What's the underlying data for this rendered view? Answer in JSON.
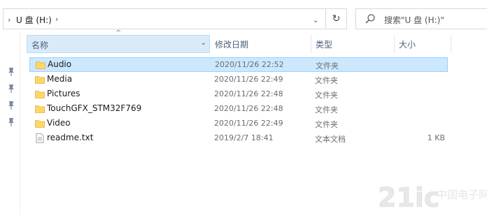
{
  "address": {
    "path": "U 盘 (H:)",
    "refresh_icon": "refresh-icon"
  },
  "search": {
    "placeholder": "搜索\"U 盘 (H:)\""
  },
  "columns": {
    "name": "名称",
    "date": "修改日期",
    "type": "类型",
    "size": "大小"
  },
  "files": [
    {
      "name": "Audio",
      "date": "2020/11/26 22:52",
      "type": "文件夹",
      "size": "",
      "icon": "folder-icon",
      "selected": true
    },
    {
      "name": "Media",
      "date": "2020/11/26 22:49",
      "type": "文件夹",
      "size": "",
      "icon": "folder-icon"
    },
    {
      "name": "Pictures",
      "date": "2020/11/26 22:48",
      "type": "文件夹",
      "size": "",
      "icon": "folder-icon"
    },
    {
      "name": "TouchGFX_STM32F769",
      "date": "2020/11/26 22:48",
      "type": "文件夹",
      "size": "",
      "icon": "folder-icon"
    },
    {
      "name": "Video",
      "date": "2020/11/26 22:49",
      "type": "文件夹",
      "size": "",
      "icon": "folder-icon"
    },
    {
      "name": "readme.txt",
      "date": "2019/2/7 18:41",
      "type": "文本文档",
      "size": "1 KB",
      "icon": "text-file-icon"
    }
  ],
  "colors": {
    "selection": "#cce8ff",
    "selection_border": "#99d1ff",
    "header_active": "#d9ebf9",
    "folder": "#ffd767"
  },
  "watermark": {
    "logo_text": "21ic",
    "cn_text": "中国电子网"
  }
}
